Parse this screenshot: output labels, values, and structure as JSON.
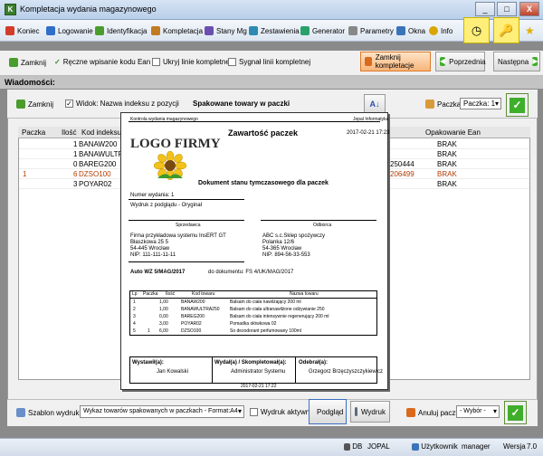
{
  "window": {
    "title": "Kompletacja wydania magazynowego",
    "icon": "app-icon",
    "min": "_",
    "max": "□",
    "close": "X"
  },
  "menu": [
    {
      "label": "Koniec",
      "icon": "exit-icon",
      "color": "#d33b2a"
    },
    {
      "label": "Logowanie",
      "icon": "login-icon",
      "color": "#2f6ec9"
    },
    {
      "label": "Identyfikacja",
      "icon": "id-icon",
      "color": "#4a9c2d"
    },
    {
      "label": "Kompletacja",
      "icon": "box-icon",
      "color": "#c27b21"
    },
    {
      "label": "Stany Mg",
      "icon": "stock-icon",
      "color": "#6a4fb0"
    },
    {
      "label": "Zestawienia",
      "icon": "report-icon",
      "color": "#2d8ab0"
    },
    {
      "label": "Generator",
      "icon": "generator-icon",
      "color": "#2aa06a"
    },
    {
      "label": "Parametry",
      "icon": "params-icon",
      "color": "#888888"
    },
    {
      "label": "Okna",
      "icon": "windows-icon",
      "color": "#3a73b8"
    },
    {
      "label": "Info",
      "icon": "info-icon",
      "color": "#d9a600"
    }
  ],
  "toolbar": {
    "close": "Zamknij",
    "manual_ean": "Ręczne wpisanie kodu Ean",
    "hide_complete": "Ukryj linie kompletne",
    "signal_complete": "Sygnał linii kompletnej",
    "close_kompletacji": "Zamknij kompletacje",
    "prev": "Poprzednia",
    "next": "Następna"
  },
  "section": {
    "title": "Wiadomości:"
  },
  "panel": {
    "close": "Zamknij",
    "view_label": "Widok: Nazwa indeksu z pozycji",
    "title": "Spakowane towary w paczki",
    "package_label": "Paczka:",
    "package_value": "Paczka: 1",
    "package_arrow": "▾",
    "confirm": "✓"
  },
  "table": {
    "headers": [
      "Paczka",
      "Ilość",
      "Kod indeksu",
      "Opakowanie Ean"
    ],
    "rows": [
      {
        "paczka": "",
        "ilosc": "1",
        "kod": "BANAW200",
        "ean": "",
        "opak": "BRAK",
        "hl": false
      },
      {
        "paczka": "",
        "ilosc": "1",
        "kod": "BANAWULTRA",
        "ean": "",
        "opak": "BRAK",
        "hl": false
      },
      {
        "paczka": "",
        "ilosc": "0",
        "kod": "BAREG200",
        "ean": "250444",
        "opak": "BRAK",
        "hl": false
      },
      {
        "paczka": "1",
        "ilosc": "6",
        "kod": "DZSO100",
        "ean": "206499",
        "opak": "BRAK",
        "hl": true
      },
      {
        "paczka": "",
        "ilosc": "3",
        "kod": "POYAR02",
        "ean": "",
        "opak": "BRAK",
        "hl": false
      }
    ]
  },
  "doc": {
    "header_left": "Kontrola wydania magazynowego",
    "header_right": "Jopal Informatyka",
    "title": "Zawartość paczek",
    "date": "2017-02-21 17:23",
    "logo": "LOGO FIRMY",
    "subtitle": "Dokument stanu tymczasowego dla paczek",
    "issue_no": "Numer wydania:   1",
    "printout": "Wydruk z podglądu - Oryginał",
    "seller_label": "Sprzedawca",
    "buyer_label": "Odbiorca",
    "seller": [
      "Firma przykładowa systemu InsERT GT",
      "Błaszkowa 25 5",
      "54-445 Wrocław",
      "NIP: 111-111-11-11"
    ],
    "buyer": [
      "ABC s.c.Sklep spożywczy",
      "Polanka 12/6",
      "54-365 Wrocław",
      "NIP: 894-56-33-553"
    ],
    "doc_no": "Auto WZ 5/MAG/2017",
    "doc_ref": "do dokumentu: FS 4/UK/MAG/2017",
    "cols": [
      "Lp",
      "Paczka",
      "Ilość",
      "Kod towaru",
      "Nazwa towaru"
    ],
    "items": [
      {
        "lp": "1",
        "paczka": "",
        "ilosc": "1,00",
        "kod": "BANAW200",
        "nazwa": "Balsam do ciała nawilżający 200 ml"
      },
      {
        "lp": "2",
        "paczka": "",
        "ilosc": "1,00",
        "kod": "BANAWULTRA250",
        "nazwa": "Balsam do ciała ultranawilżone odżywianie 250"
      },
      {
        "lp": "3",
        "paczka": "",
        "ilosc": "0,00",
        "kod": "BAREG200",
        "nazwa": "Balsam do ciała intensywnie regenerujący 200 ml"
      },
      {
        "lp": "4",
        "paczka": "",
        "ilosc": "3,00",
        "kod": "POYAR02",
        "nazwa": "Pomadka ołówkowa 02"
      },
      {
        "lp": "5",
        "paczka": "1",
        "ilosc": "6,00",
        "kod": "DZSO100",
        "nazwa": "So dezodorant perfumowany 100ml"
      }
    ],
    "sig": [
      {
        "label": "Wystawił(a):",
        "name": "Jan Kowalski"
      },
      {
        "label": "Wydał(a) / Skompletował(a):",
        "name": "Administrator Systemu"
      },
      {
        "label": "Odebrał(a):",
        "name": "Grzegorz Brzęczyszczykiewicz"
      }
    ],
    "footer_date": "2017-02-21 17:22"
  },
  "bottom": {
    "template_label": "Szablon wydruku:",
    "template_value": "Wykaz towarów spakowanych w paczkach - Format:A4",
    "active": "Wydruk aktywny",
    "preview": "Podgląd",
    "print": "Wydruk",
    "cancel_pkg": "Anuluj paczkę:",
    "choose": "- Wybór -",
    "confirm": "✓"
  },
  "status": {
    "db_label": "DB",
    "db": "JOPAL",
    "user_label": "Użytkownik",
    "user": "manager",
    "version_label": "Wersja",
    "version": "7.0"
  }
}
